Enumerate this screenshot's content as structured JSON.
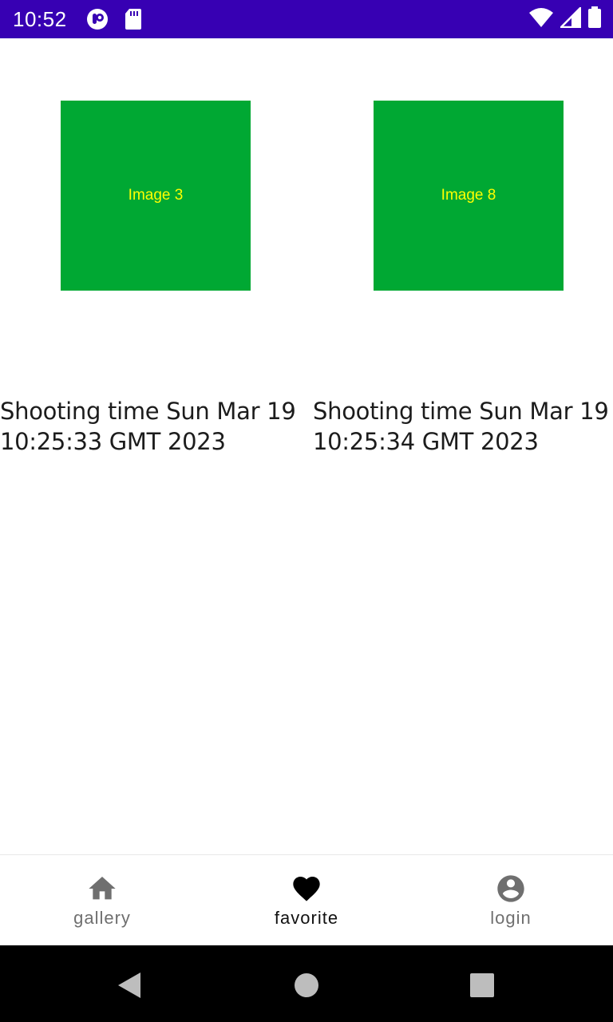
{
  "status_bar": {
    "time": "10:52",
    "left_icons": [
      "pocket-icon",
      "sd-card-icon"
    ],
    "right_icons": [
      "wifi-icon",
      "signal-icon",
      "battery-icon"
    ],
    "color": "#3700b3"
  },
  "gallery": {
    "items": [
      {
        "image_label": "Image 3",
        "caption": "Shooting time Sun Mar 19 10:25:33 GMT 2023",
        "color": "#00a833"
      },
      {
        "image_label": "Image 8",
        "caption": "Shooting time Sun Mar 19 10:25:34 GMT 2023",
        "color": "#00a833"
      }
    ]
  },
  "bottom_nav": {
    "items": [
      {
        "label": "gallery",
        "icon": "home-icon",
        "active": false
      },
      {
        "label": "favorite",
        "icon": "heart-icon",
        "active": true
      },
      {
        "label": "login",
        "icon": "account-icon",
        "active": false
      }
    ]
  },
  "system_nav": {
    "buttons": [
      "back-icon",
      "home-circle-icon",
      "recents-icon"
    ]
  }
}
